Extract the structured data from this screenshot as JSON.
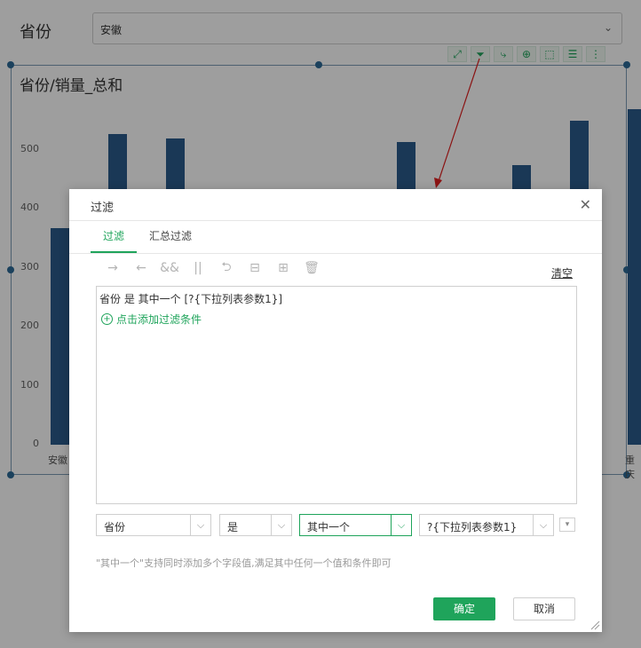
{
  "filter": {
    "label": "省份",
    "selected": "安徽"
  },
  "toolbar": {
    "icons": [
      "fullscreen-icon",
      "filter-icon",
      "drill-icon",
      "zoom-in-icon",
      "select-icon",
      "list-icon",
      "more-icon"
    ]
  },
  "chart_data": {
    "type": "bar",
    "title": "省份/销量_总和",
    "yticks": [
      "500",
      "400",
      "300",
      "200",
      "100",
      "0"
    ],
    "ylim": [
      0,
      580
    ],
    "categories": [
      "安徽",
      "",
      "",
      "",
      "",
      "",
      "",
      "",
      "",
      "",
      "重庆"
    ],
    "values": [
      368,
      527,
      520,
      0,
      0,
      432,
      513,
      0,
      475,
      550,
      570
    ],
    "color": "#2b5b8c"
  },
  "dialog": {
    "title": "过滤",
    "tabs": [
      "过滤",
      "汇总过滤"
    ],
    "clear_label": "清空",
    "condition_line": "省份 是 其中一个 [?{下拉列表参数1}]",
    "add_condition": "点击添加过滤条件",
    "field_select": "省份",
    "operator_select": "是",
    "mode_select": "其中一个",
    "value_select": "?{下拉列表参数1}",
    "hint": "\"其中一个\"支持同时添加多个字段值,满足其中任何一个值和条件即可",
    "ok_label": "确定",
    "cancel_label": "取消"
  },
  "colors": {
    "accent": "#1fa45b",
    "bar": "#2b5b8c",
    "annotation": "#e02020"
  }
}
